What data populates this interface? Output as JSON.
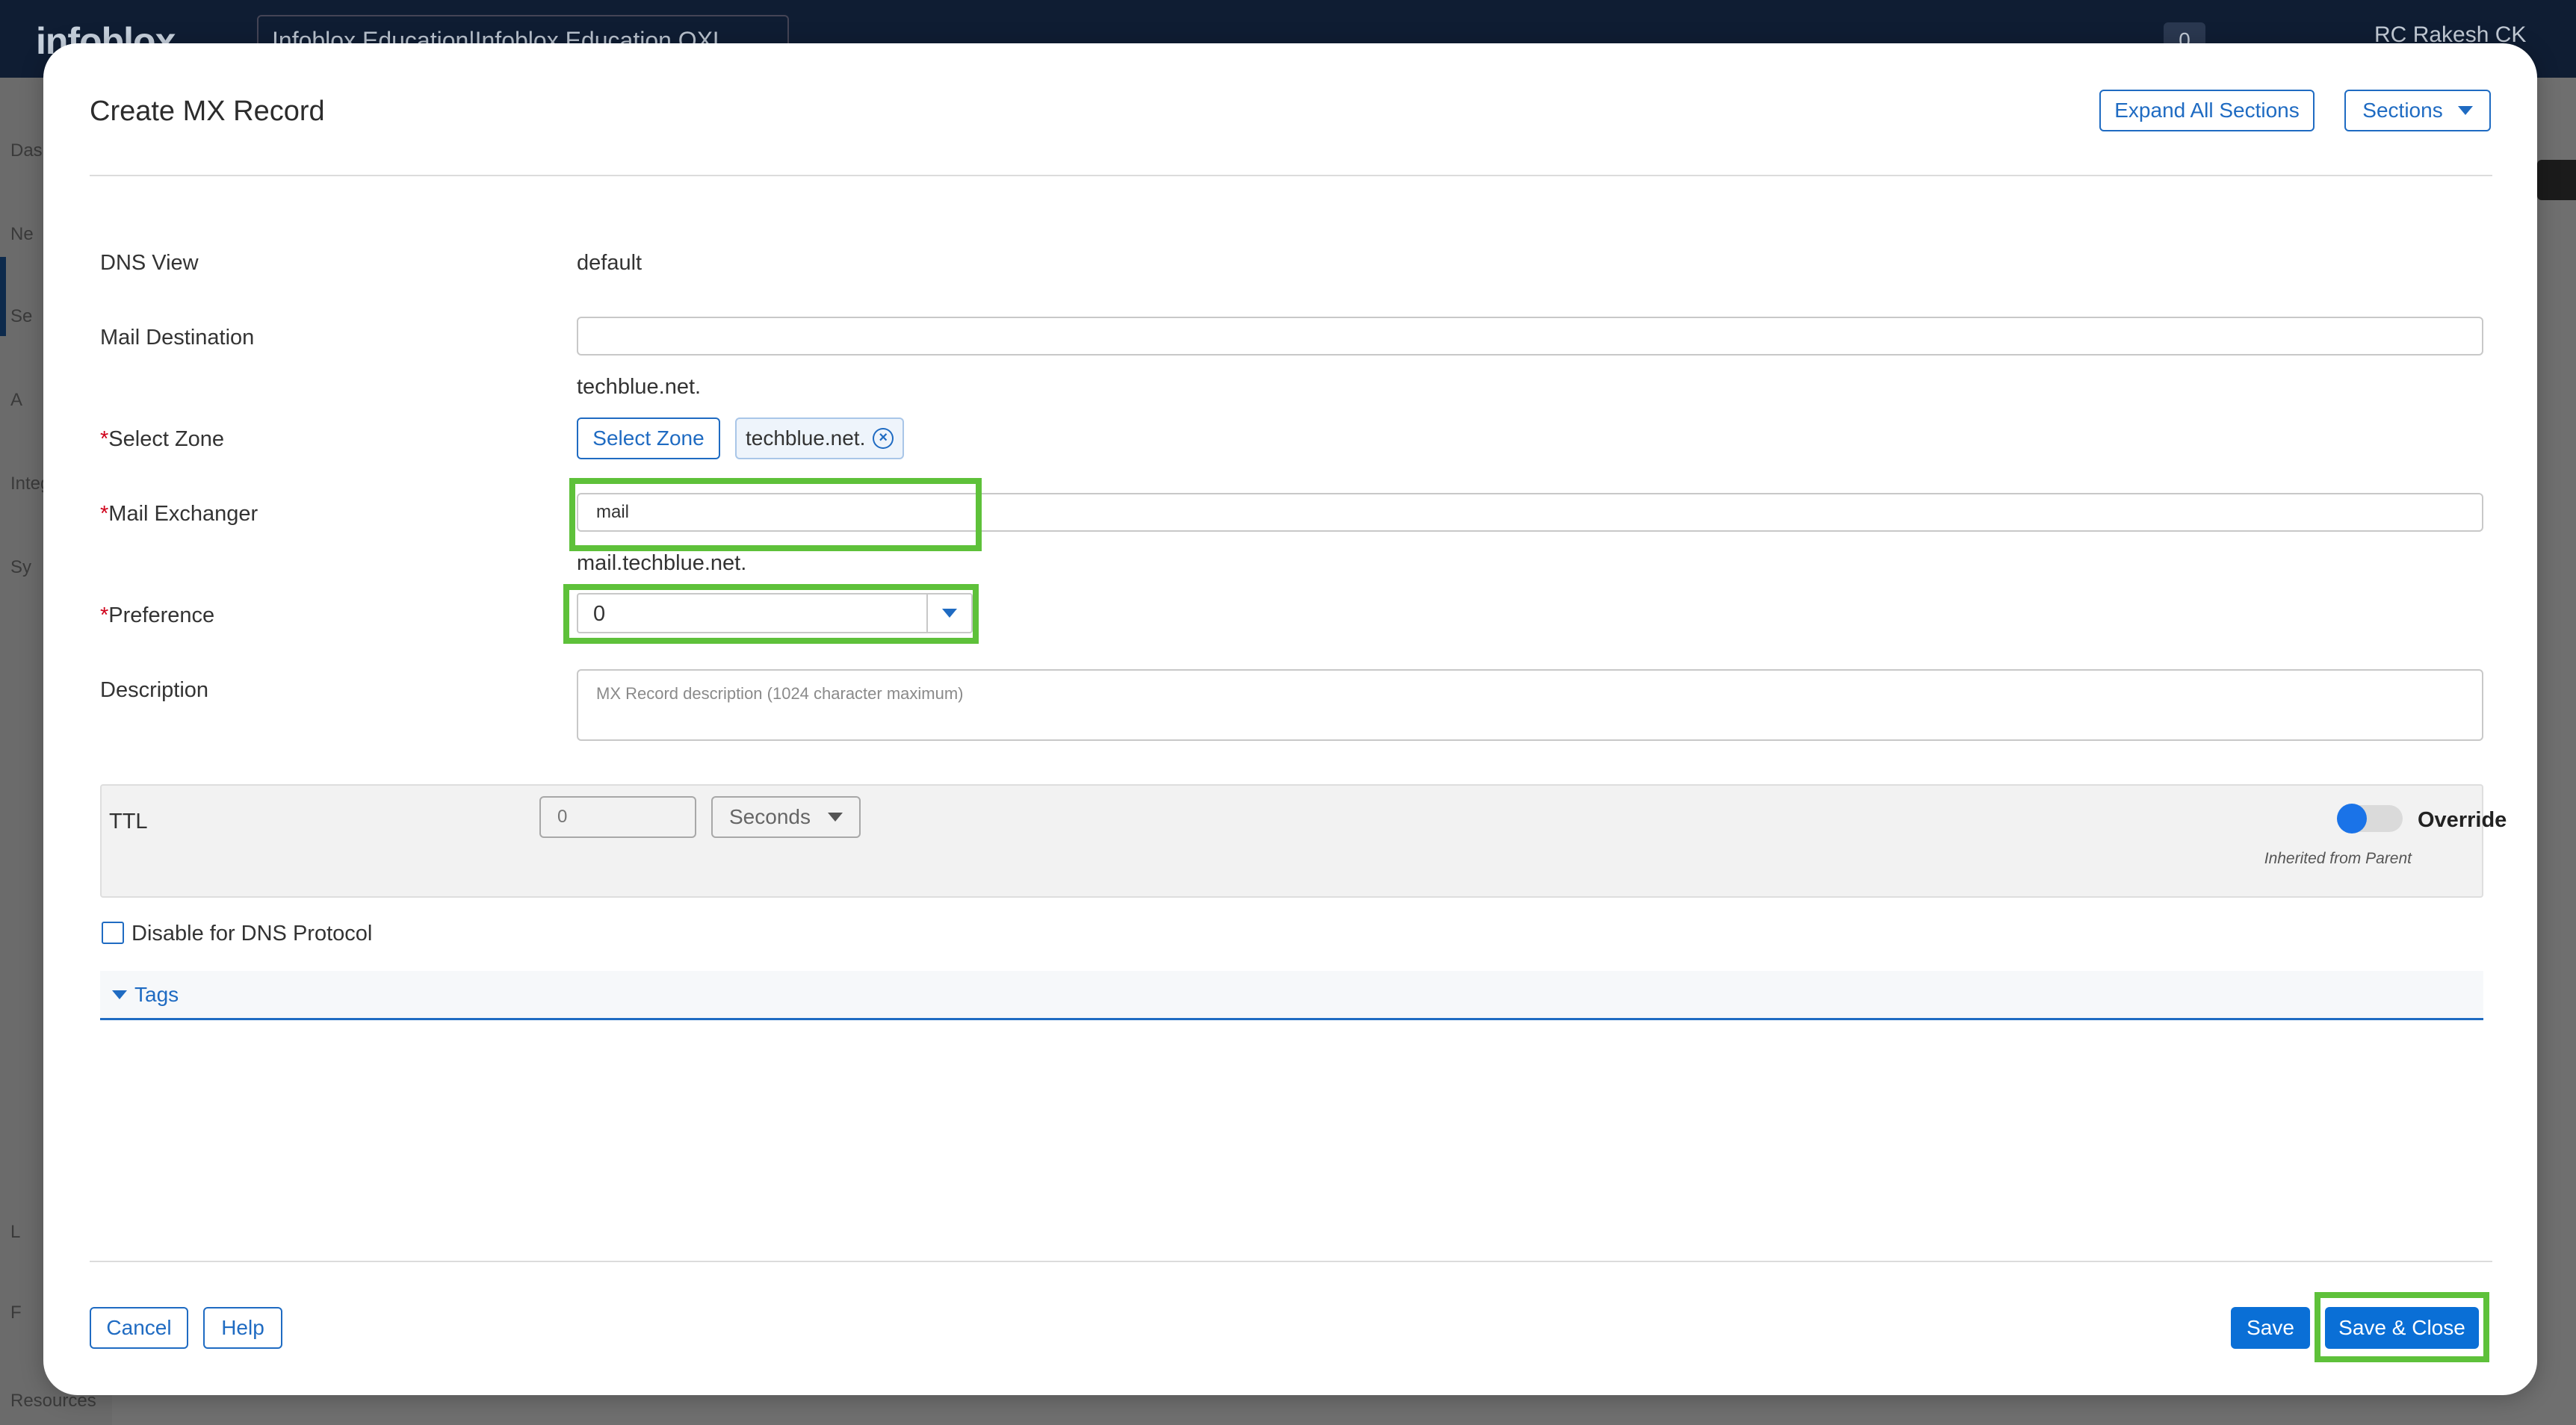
{
  "background": {
    "logo": "infoblox",
    "account_selector": "Infoblox Education|Infoblox Education OXL",
    "notification_count": "0",
    "user_initials": "RC",
    "user_name": "Rakesh CK",
    "sidebar_items": [
      "Das",
      "Ne",
      "Se",
      "A",
      "Integ",
      "Sy",
      "L",
      "F",
      "Resources"
    ]
  },
  "modal": {
    "title": "Create MX Record",
    "expand_all_label": "Expand All Sections",
    "sections_label": "Sections"
  },
  "form": {
    "dns_view": {
      "label": "DNS View",
      "value": "default"
    },
    "mail_destination": {
      "label": "Mail Destination",
      "value": "",
      "hint": "techblue.net."
    },
    "select_zone": {
      "required": "*",
      "label": "Select Zone",
      "button_label": "Select Zone",
      "chip_label": "techblue.net."
    },
    "mail_exchanger": {
      "required": "*",
      "label": "Mail Exchanger",
      "value": "mail",
      "hint": "mail.techblue.net."
    },
    "preference": {
      "required": "*",
      "label": "Preference",
      "value": "0"
    },
    "description": {
      "label": "Description",
      "placeholder": "MX Record description (1024 character maximum)"
    },
    "ttl": {
      "label": "TTL",
      "placeholder": "0",
      "unit": "Seconds",
      "override_label": "Override",
      "inherited_text": "Inherited from Parent",
      "override_on": false
    },
    "disable_dns": {
      "label": "Disable for DNS Protocol",
      "checked": false
    },
    "tags": {
      "label": "Tags",
      "expanded": false
    }
  },
  "footer": {
    "cancel_label": "Cancel",
    "help_label": "Help",
    "save_label": "Save",
    "save_close_label": "Save & Close"
  },
  "colors": {
    "accent": "#1f6bc2",
    "primary_button": "#0a6fd6",
    "highlight": "#5ec13a"
  }
}
